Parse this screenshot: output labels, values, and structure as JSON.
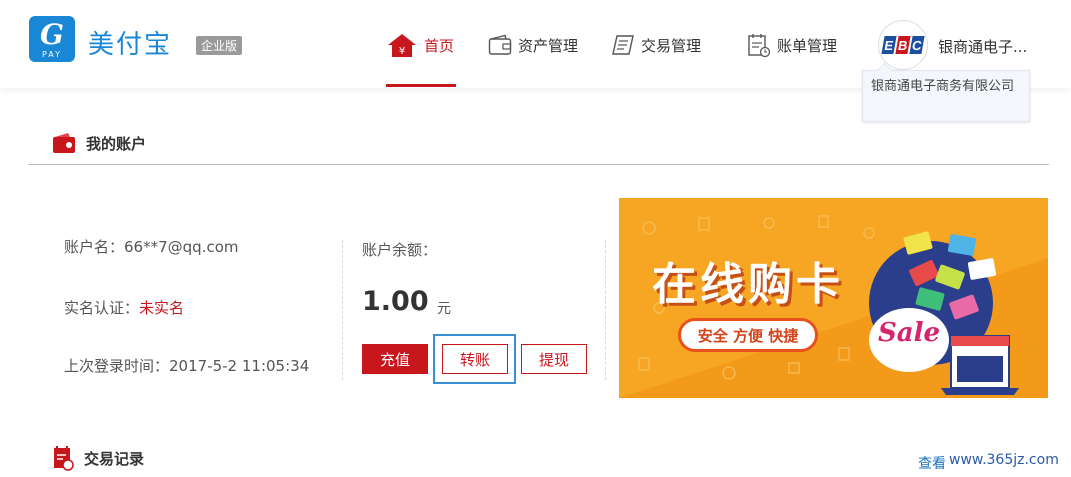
{
  "header": {
    "brand": "美付宝",
    "logo_text": "PAY",
    "edition": "企业版",
    "nav": [
      {
        "label": "首页",
        "icon": "home-icon",
        "active": true
      },
      {
        "label": "资产管理",
        "icon": "wallet-icon",
        "active": false
      },
      {
        "label": "交易管理",
        "icon": "notebook-icon",
        "active": false
      },
      {
        "label": "账单管理",
        "icon": "bill-icon",
        "active": false
      }
    ],
    "company_logo_letters": [
      "E",
      "B",
      "C"
    ],
    "company_short": "银商通电子...",
    "company_full": "银商通电子商务有限公司"
  },
  "account": {
    "title": "我的账户",
    "name_label": "账户名：",
    "name_value": "66**7@qq.com",
    "verify_label": "实名认证：",
    "verify_value": "未实名",
    "last_login_label": "上次登录时间：",
    "last_login_value": "2017-5-2  11:05:34",
    "balance_label": "账户余额：",
    "balance_value": "1.00",
    "balance_unit": "元",
    "buttons": {
      "recharge": "充值",
      "transfer": "转账",
      "withdraw": "提现"
    }
  },
  "banner": {
    "title": "在线购卡",
    "subtitle": "安全  方便  快捷",
    "sale": "Sale"
  },
  "transactions": {
    "title": "交易记录",
    "view_more": "查看"
  },
  "watermark": "www.365jz.com",
  "colors": {
    "brand_blue": "#1a87d6",
    "accent_red": "#c8161d",
    "banner_orange": "#f6a623"
  }
}
